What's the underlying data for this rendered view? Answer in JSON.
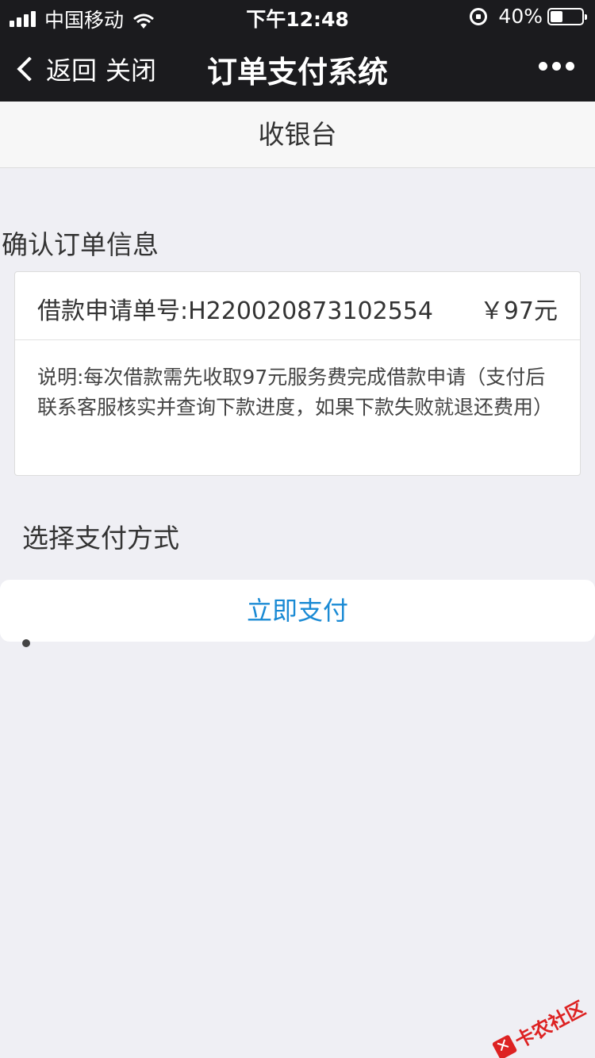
{
  "status_bar": {
    "carrier": "中国移动",
    "time": "下午12:48",
    "battery": "40%",
    "battery_level": 0.4,
    "icons": [
      "signal-icon",
      "wifi-icon",
      "rotation-lock-icon",
      "battery-icon"
    ]
  },
  "nav": {
    "back_label": "返回",
    "close_label": "关闭",
    "title": "订单支付系统",
    "more_icon": "more-dots-icon"
  },
  "cashier": {
    "title": "收银台"
  },
  "order": {
    "section_title": "确认订单信息",
    "number_label": "借款申请单号:H220020873102554",
    "amount": "￥97元",
    "description": "说明:每次借款需先收取97元服务费完成借款申请（支付后联系客服核实并查询下款进度，如果下款失败就退还费用）"
  },
  "payment": {
    "section_title": "选择支付方式",
    "pay_button_label": "立即支付"
  },
  "watermark": {
    "text": "卡农社区"
  },
  "colors": {
    "nav_bg": "#1b1b1e",
    "page_bg": "#efeff4",
    "accent": "#1a8ad4"
  }
}
